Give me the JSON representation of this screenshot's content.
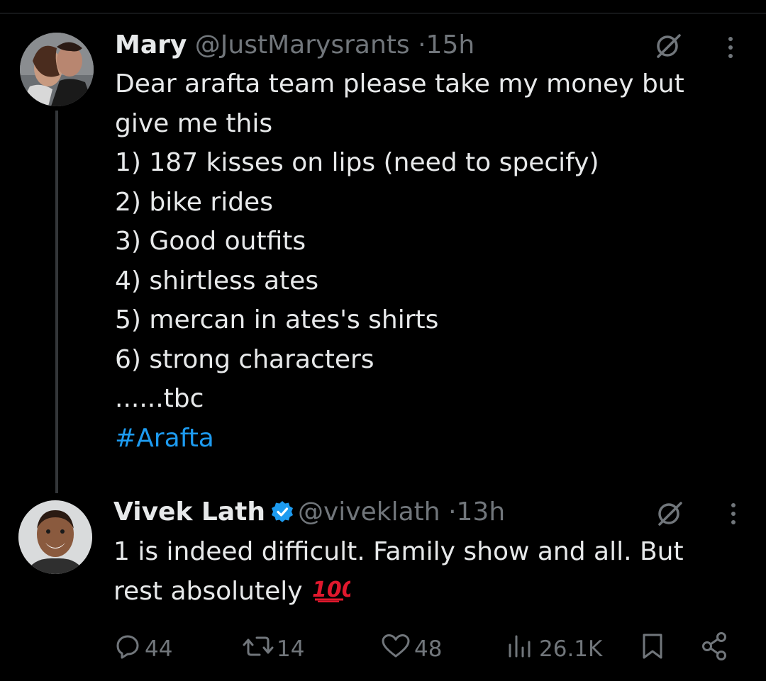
{
  "tweet1": {
    "name": "Mary",
    "handle": "@JustMarysrants",
    "separator": "·",
    "time": "15h",
    "lines": [
      "Dear arafta team please take my money but",
      "give me this",
      "1) 187 kisses on lips (need to specify)",
      "2) bike rides",
      "3) Good outfits",
      "4) shirtless ates",
      "5) mercan in ates's shirts",
      "6) strong characters",
      "......tbc"
    ],
    "hashtag": "#Arafta"
  },
  "tweet2": {
    "name": "Vivek Lath",
    "handle": "@viveklath",
    "separator": "·",
    "time": "13h",
    "line1": "1 is indeed difficult. Family show and all. But",
    "line2": "rest absolutely"
  },
  "actions": {
    "replies": "44",
    "reposts": "14",
    "likes": "48",
    "views": "26.1K"
  },
  "icons": {
    "grok": "grok-icon",
    "more": "more-vertical-icon",
    "reply": "reply-icon",
    "repost": "repost-icon",
    "like": "heart-icon",
    "views": "views-icon",
    "bookmark": "bookmark-icon",
    "share": "share-icon",
    "verified": "verified-badge-icon",
    "emoji": "hundred-points-emoji"
  },
  "colors": {
    "background": "#000000",
    "text": "#e7e9ea",
    "muted": "#71767b",
    "link": "#1d9bf0",
    "verified": "#1d9bf0",
    "hundred": "#e0182d"
  }
}
